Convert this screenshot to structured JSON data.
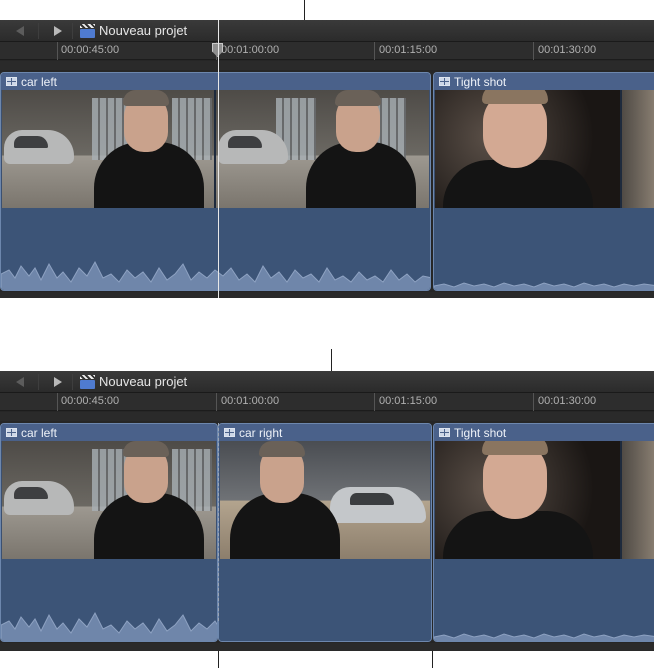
{
  "top": {
    "project_title": "Nouveau projet",
    "timecodes": [
      "00:00:45:00",
      "00:01:00:00",
      "00:01:15:00",
      "00:01:30:00"
    ],
    "clips": [
      "car left",
      "Tight shot"
    ]
  },
  "bottom": {
    "project_title": "Nouveau projet",
    "timecodes": [
      "00:00:45:00",
      "00:01:00:00",
      "00:01:15:00",
      "00:01:30:00"
    ],
    "clips": [
      "car left",
      "car right",
      "Tight shot"
    ]
  },
  "icons": {
    "back": "chevron-left-icon",
    "forward": "chevron-right-icon",
    "project": "clapperboard-icon",
    "clip": "filmstrip-icon"
  },
  "colors": {
    "clip_fill": "#3b5071",
    "clip_border": "#6d87ad",
    "panel_bg": "#262626"
  }
}
